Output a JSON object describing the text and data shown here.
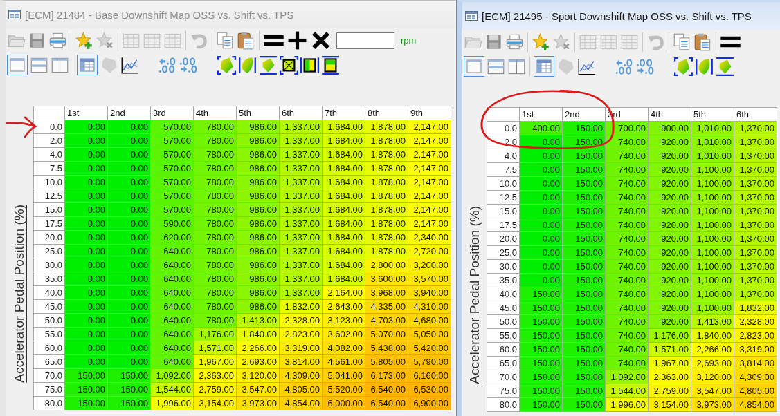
{
  "windows": [
    {
      "title": "[ECM] 21484 - Base Downshift Map OSS vs. Shift vs. TPS",
      "active": false,
      "unit": "rpm",
      "axis_label": "Accelerator Pedal Position (%)",
      "table": {
        "columns": [
          "1st",
          "2nd",
          "3rd",
          "4th",
          "5th",
          "6th",
          "7th",
          "8th",
          "9th"
        ],
        "rows": [
          {
            "label": "0.0",
            "cells": [
              "0.00",
              "0.00",
              "570.00",
              "780.00",
              "986.00",
              "1,337.00",
              "1,684.00",
              "1,878.00",
              "2,147.00"
            ]
          },
          {
            "label": "2.0",
            "cells": [
              "0.00",
              "0.00",
              "570.00",
              "780.00",
              "986.00",
              "1,337.00",
              "1,684.00",
              "1,878.00",
              "2,147.00"
            ]
          },
          {
            "label": "4.0",
            "cells": [
              "0.00",
              "0.00",
              "570.00",
              "780.00",
              "986.00",
              "1,337.00",
              "1,684.00",
              "1,878.00",
              "2,147.00"
            ]
          },
          {
            "label": "7.5",
            "cells": [
              "0.00",
              "0.00",
              "570.00",
              "780.00",
              "986.00",
              "1,337.00",
              "1,684.00",
              "1,878.00",
              "2,147.00"
            ]
          },
          {
            "label": "10.0",
            "cells": [
              "0.00",
              "0.00",
              "570.00",
              "780.00",
              "986.00",
              "1,337.00",
              "1,684.00",
              "1,878.00",
              "2,147.00"
            ]
          },
          {
            "label": "12.5",
            "cells": [
              "0.00",
              "0.00",
              "570.00",
              "780.00",
              "986.00",
              "1,337.00",
              "1,684.00",
              "1,878.00",
              "2,147.00"
            ]
          },
          {
            "label": "15.0",
            "cells": [
              "0.00",
              "0.00",
              "570.00",
              "780.00",
              "986.00",
              "1,337.00",
              "1,684.00",
              "1,878.00",
              "2,147.00"
            ]
          },
          {
            "label": "17.5",
            "cells": [
              "0.00",
              "0.00",
              "590.00",
              "780.00",
              "986.00",
              "1,337.00",
              "1,684.00",
              "1,878.00",
              "2,147.00"
            ]
          },
          {
            "label": "20.0",
            "cells": [
              "0.00",
              "0.00",
              "620.00",
              "780.00",
              "986.00",
              "1,337.00",
              "1,684.00",
              "1,878.00",
              "2,340.00"
            ]
          },
          {
            "label": "25.0",
            "cells": [
              "0.00",
              "0.00",
              "640.00",
              "780.00",
              "986.00",
              "1,337.00",
              "1,684.00",
              "1,878.00",
              "2,720.00"
            ]
          },
          {
            "label": "30.0",
            "cells": [
              "0.00",
              "0.00",
              "640.00",
              "780.00",
              "986.00",
              "1,337.00",
              "1,684.00",
              "2,800.00",
              "3,200.00"
            ]
          },
          {
            "label": "35.0",
            "cells": [
              "0.00",
              "0.00",
              "640.00",
              "780.00",
              "986.00",
              "1,337.00",
              "1,684.00",
              "3,600.00",
              "3,570.00"
            ]
          },
          {
            "label": "40.0",
            "cells": [
              "0.00",
              "0.00",
              "640.00",
              "780.00",
              "986.00",
              "1,337.00",
              "2,164.00",
              "3,968.00",
              "3,940.00"
            ]
          },
          {
            "label": "45.0",
            "cells": [
              "0.00",
              "0.00",
              "640.00",
              "780.00",
              "986.00",
              "1,832.00",
              "2,643.00",
              "4,335.00",
              "4,310.00"
            ]
          },
          {
            "label": "50.0",
            "cells": [
              "0.00",
              "0.00",
              "640.00",
              "780.00",
              "1,413.00",
              "2,328.00",
              "3,123.00",
              "4,703.00",
              "4,680.00"
            ]
          },
          {
            "label": "55.0",
            "cells": [
              "0.00",
              "0.00",
              "640.00",
              "1,176.00",
              "1,840.00",
              "2,823.00",
              "3,602.00",
              "5,070.00",
              "5,050.00"
            ]
          },
          {
            "label": "60.0",
            "cells": [
              "0.00",
              "0.00",
              "640.00",
              "1,571.00",
              "2,266.00",
              "3,319.00",
              "4,082.00",
              "5,438.00",
              "5,420.00"
            ]
          },
          {
            "label": "65.0",
            "cells": [
              "0.00",
              "0.00",
              "640.00",
              "1,967.00",
              "2,693.00",
              "3,814.00",
              "4,561.00",
              "5,805.00",
              "5,790.00"
            ]
          },
          {
            "label": "70.0",
            "cells": [
              "150.00",
              "150.00",
              "1,092.00",
              "2,363.00",
              "3,120.00",
              "4,309.00",
              "5,041.00",
              "6,173.00",
              "6,160.00"
            ]
          },
          {
            "label": "75.0",
            "cells": [
              "150.00",
              "150.00",
              "1,544.00",
              "2,759.00",
              "3,547.00",
              "4,805.00",
              "5,520.00",
              "6,540.00",
              "6,530.00"
            ]
          },
          {
            "label": "80.0",
            "cells": [
              "150.00",
              "150.00",
              "1,996.00",
              "3,154.00",
              "3,973.00",
              "4,854.00",
              "6,000.00",
              "6,540.00",
              "6,900.00"
            ]
          }
        ]
      }
    },
    {
      "title": "[ECM] 21495 - Sport Downshift Map OSS vs. Shift vs. TPS",
      "active": true,
      "axis_label": "Accelerator Pedal Position (%)",
      "table": {
        "columns": [
          "1st",
          "2nd",
          "3rd",
          "4th",
          "5th",
          "6th"
        ],
        "rows": [
          {
            "label": "0.0",
            "cells": [
              "400.00",
              "150.00",
              "700.00",
              "900.00",
              "1,010.00",
              "1,370.00"
            ]
          },
          {
            "label": "2.0",
            "cells": [
              "0.00",
              "150.00",
              "740.00",
              "920.00",
              "1,010.00",
              "1,370.00"
            ]
          },
          {
            "label": "4.0",
            "cells": [
              "0.00",
              "150.00",
              "740.00",
              "920.00",
              "1,010.00",
              "1,370.00"
            ]
          },
          {
            "label": "7.5",
            "cells": [
              "0.00",
              "150.00",
              "740.00",
              "920.00",
              "1,100.00",
              "1,370.00"
            ]
          },
          {
            "label": "10.0",
            "cells": [
              "0.00",
              "150.00",
              "740.00",
              "920.00",
              "1,100.00",
              "1,370.00"
            ]
          },
          {
            "label": "12.5",
            "cells": [
              "0.00",
              "150.00",
              "740.00",
              "920.00",
              "1,100.00",
              "1,370.00"
            ]
          },
          {
            "label": "15.0",
            "cells": [
              "0.00",
              "150.00",
              "740.00",
              "920.00",
              "1,100.00",
              "1,370.00"
            ]
          },
          {
            "label": "17.5",
            "cells": [
              "0.00",
              "150.00",
              "740.00",
              "920.00",
              "1,100.00",
              "1,370.00"
            ]
          },
          {
            "label": "20.0",
            "cells": [
              "0.00",
              "150.00",
              "740.00",
              "920.00",
              "1,100.00",
              "1,370.00"
            ]
          },
          {
            "label": "25.0",
            "cells": [
              "0.00",
              "150.00",
              "740.00",
              "920.00",
              "1,100.00",
              "1,370.00"
            ]
          },
          {
            "label": "30.0",
            "cells": [
              "0.00",
              "150.00",
              "740.00",
              "920.00",
              "1,100.00",
              "1,370.00"
            ]
          },
          {
            "label": "35.0",
            "cells": [
              "0.00",
              "150.00",
              "740.00",
              "920.00",
              "1,100.00",
              "1,370.00"
            ]
          },
          {
            "label": "40.0",
            "cells": [
              "150.00",
              "150.00",
              "740.00",
              "920.00",
              "1,100.00",
              "1,370.00"
            ]
          },
          {
            "label": "45.0",
            "cells": [
              "150.00",
              "150.00",
              "740.00",
              "920.00",
              "1,100.00",
              "1,832.00"
            ]
          },
          {
            "label": "50.0",
            "cells": [
              "150.00",
              "150.00",
              "740.00",
              "920.00",
              "1,413.00",
              "2,328.00"
            ]
          },
          {
            "label": "55.0",
            "cells": [
              "150.00",
              "150.00",
              "740.00",
              "1,176.00",
              "1,840.00",
              "2,823.00"
            ]
          },
          {
            "label": "60.0",
            "cells": [
              "150.00",
              "150.00",
              "740.00",
              "1,571.00",
              "2,266.00",
              "3,319.00"
            ]
          },
          {
            "label": "65.0",
            "cells": [
              "150.00",
              "150.00",
              "740.00",
              "1,967.00",
              "2,693.00",
              "3,814.00"
            ]
          },
          {
            "label": "70.0",
            "cells": [
              "150.00",
              "150.00",
              "1,092.00",
              "2,363.00",
              "3,120.00",
              "4,309.00"
            ]
          },
          {
            "label": "75.0",
            "cells": [
              "150.00",
              "150.00",
              "1,544.00",
              "2,759.00",
              "3,547.00",
              "4,805.00"
            ]
          },
          {
            "label": "80.0",
            "cells": [
              "150.00",
              "150.00",
              "1,996.00",
              "3,154.00",
              "3,973.00",
              "4,854.00"
            ]
          }
        ]
      }
    }
  ]
}
